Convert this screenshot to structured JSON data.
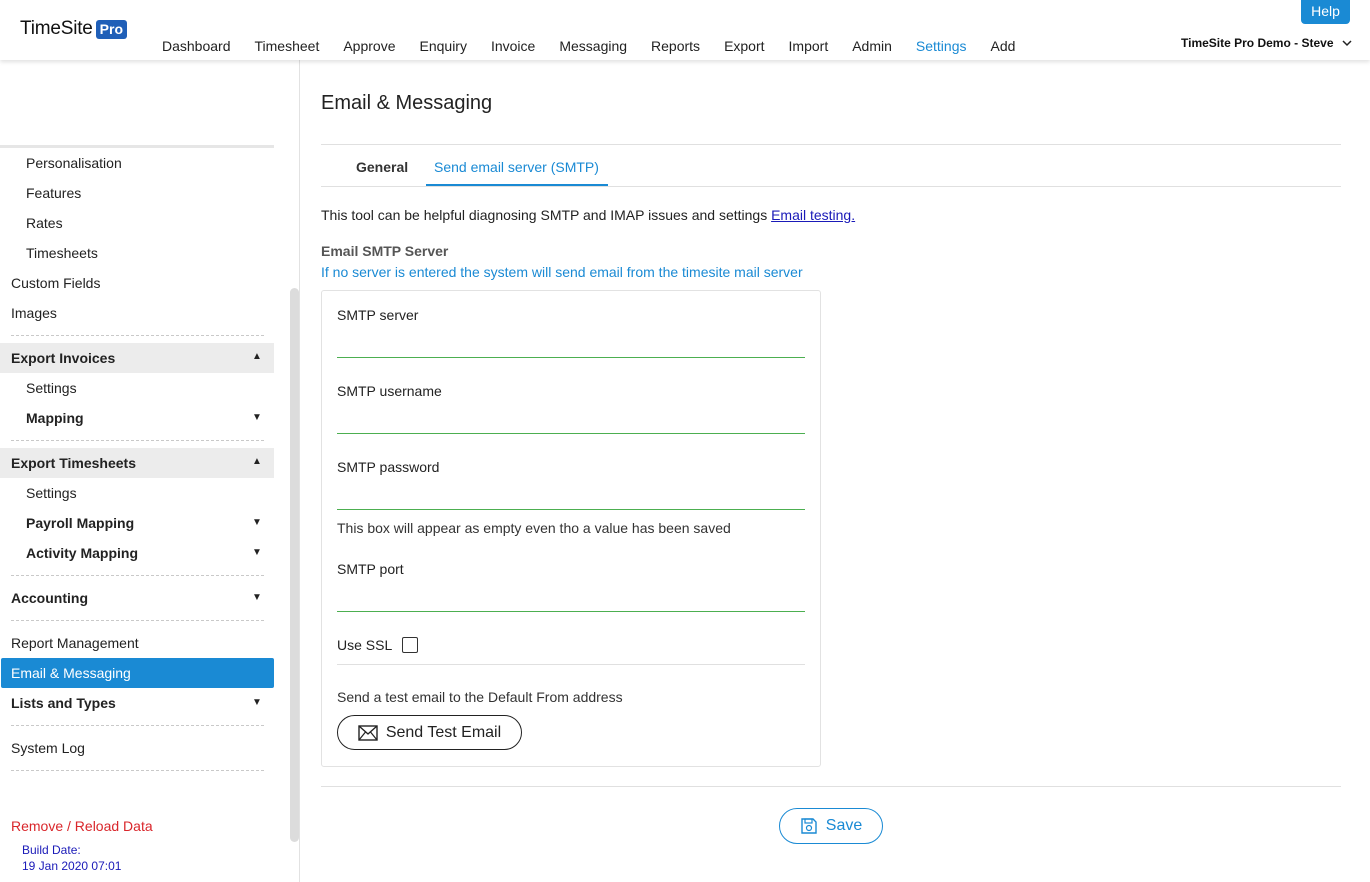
{
  "header": {
    "logo_text": "TimeSite",
    "logo_badge": "Pro",
    "help_label": "Help",
    "account_label": "TimeSite Pro Demo - Steve",
    "nav": [
      "Dashboard",
      "Timesheet",
      "Approve",
      "Enquiry",
      "Invoice",
      "Messaging",
      "Reports",
      "Export",
      "Import",
      "Admin",
      "Settings",
      "Add"
    ],
    "active_nav": "Settings"
  },
  "sidebar": {
    "items": {
      "personalisation": "Personalisation",
      "features": "Features",
      "rates": "Rates",
      "timesheets": "Timesheets",
      "custom_fields": "Custom Fields",
      "images": "Images",
      "export_invoices": "Export Invoices",
      "ei_settings": "Settings",
      "ei_mapping": "Mapping",
      "export_timesheets": "Export Timesheets",
      "et_settings": "Settings",
      "payroll_mapping": "Payroll Mapping",
      "activity_mapping": "Activity Mapping",
      "accounting": "Accounting",
      "report_management": "Report Management",
      "email_messaging": "Email & Messaging",
      "lists_types": "Lists and Types",
      "system_log": "System Log"
    },
    "remove_reload": "Remove / Reload Data",
    "build_label": "Build Date:",
    "build_date": "19 Jan 2020 07:01"
  },
  "main": {
    "title": "Email & Messaging",
    "tabs": {
      "general": "General",
      "smtp": "Send email server (SMTP)"
    },
    "active_tab": "Send email server (SMTP)",
    "intro_text": "This tool can be helpful diagnosing SMTP and IMAP issues and settings ",
    "intro_link": "Email testing.",
    "section_title": "Email SMTP Server",
    "section_sub": "If no server is entered the system will send email from the timesite mail server",
    "fields": {
      "server_label": "SMTP server",
      "server_value": "",
      "username_label": "SMTP username",
      "username_value": "",
      "password_label": "SMTP password",
      "password_value": "",
      "password_hint": "This box will appear as empty even tho a value has been saved",
      "port_label": "SMTP port",
      "port_value": ""
    },
    "use_ssl_label": "Use SSL",
    "use_ssl_checked": false,
    "test_label": "Send a test email to the Default From address",
    "test_button": "Send Test Email",
    "save_button": "Save"
  },
  "colors": {
    "accent": "#1a8ad4",
    "danger": "#d9262b",
    "link": "#1a1ab8",
    "input_underline": "#4caf50"
  }
}
